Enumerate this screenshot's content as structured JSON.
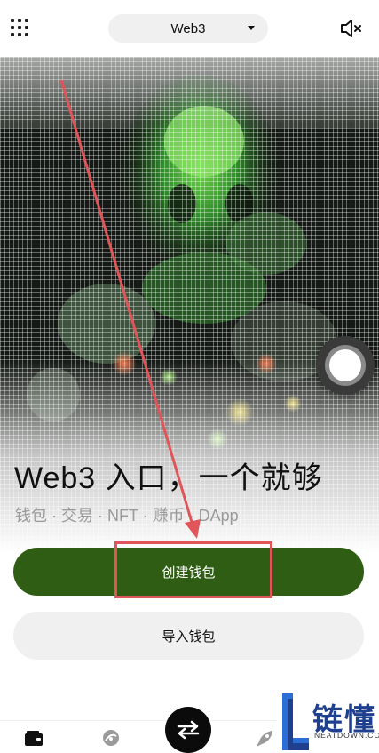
{
  "header": {
    "network_selector": "Web3",
    "menu_icon": "grid-icon",
    "mute_icon": "speaker-muted-icon"
  },
  "hero": {
    "title": "Web3 入口，一个就够",
    "subtitle": "钱包 · 交易 · NFT · 赚币 · DApp"
  },
  "actions": {
    "create_wallet": "创建钱包",
    "import_wallet": "导入钱包"
  },
  "bottom_nav": {
    "items": [
      {
        "icon": "wallet-icon"
      },
      {
        "icon": "market-icon"
      },
      {
        "icon": "swap-icon"
      },
      {
        "icon": "discover-rocket-icon"
      }
    ]
  },
  "watermark": {
    "title": "链懂",
    "subtitle": "NEATDOWN.COM"
  },
  "colors": {
    "primary": "#2f5d14",
    "secondary_button": "#f0f0f0",
    "annotation": "#e0555a",
    "watermark": "#1f3f8f"
  }
}
